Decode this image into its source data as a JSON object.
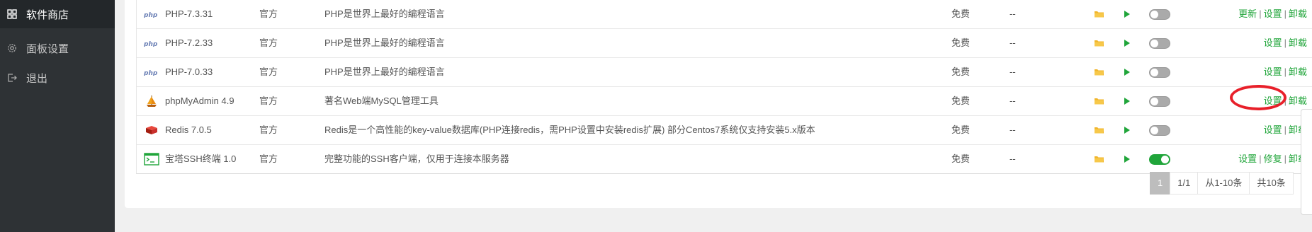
{
  "sidebar": {
    "items": [
      {
        "label": "软件商店",
        "icon": "grid-icon",
        "active": true
      },
      {
        "label": "面板设置",
        "icon": "gear-icon",
        "active": false
      },
      {
        "label": "退出",
        "icon": "logout-icon",
        "active": false
      }
    ]
  },
  "table": {
    "rows": [
      {
        "name": "PHP-7.3.31",
        "source": "官方",
        "desc": "PHP是世界上最好的编程语言",
        "price": "免费",
        "expire": "--",
        "enabled": false,
        "ops": [
          "更新",
          "设置",
          "卸载"
        ]
      },
      {
        "name": "PHP-7.2.33",
        "source": "官方",
        "desc": "PHP是世界上最好的编程语言",
        "price": "免费",
        "expire": "--",
        "enabled": false,
        "ops": [
          "设置",
          "卸载"
        ]
      },
      {
        "name": "PHP-7.0.33",
        "source": "官方",
        "desc": "PHP是世界上最好的编程语言",
        "price": "免费",
        "expire": "--",
        "enabled": false,
        "ops": [
          "设置",
          "卸载"
        ]
      },
      {
        "name": "phpMyAdmin 4.9",
        "source": "官方",
        "desc": "著名Web端MySQL管理工具",
        "price": "免费",
        "expire": "--",
        "enabled": false,
        "ops": [
          "设置",
          "卸载"
        ]
      },
      {
        "name": "Redis 7.0.5",
        "source": "官方",
        "desc": "Redis是一个高性能的key-value数据库(PHP连接redis，需PHP设置中安装redis扩展) 部分Centos7系统仅支持安装5.x版本",
        "price": "免费",
        "expire": "--",
        "enabled": false,
        "ops": [
          "设置",
          "卸载"
        ]
      },
      {
        "name": "宝塔SSH终端 1.0",
        "source": "官方",
        "desc": "完整功能的SSH客户端，仅用于连接本服务器",
        "price": "免费",
        "expire": "--",
        "enabled": true,
        "ops": [
          "设置",
          "修复",
          "卸载"
        ]
      }
    ]
  },
  "pager": {
    "current": "1",
    "pages": "1/1",
    "range": "从1-10条",
    "total": "共10条"
  },
  "colors": {
    "accent": "#20a53a",
    "sidebar_bg": "#2e3235",
    "annotation": "#e8202a"
  }
}
